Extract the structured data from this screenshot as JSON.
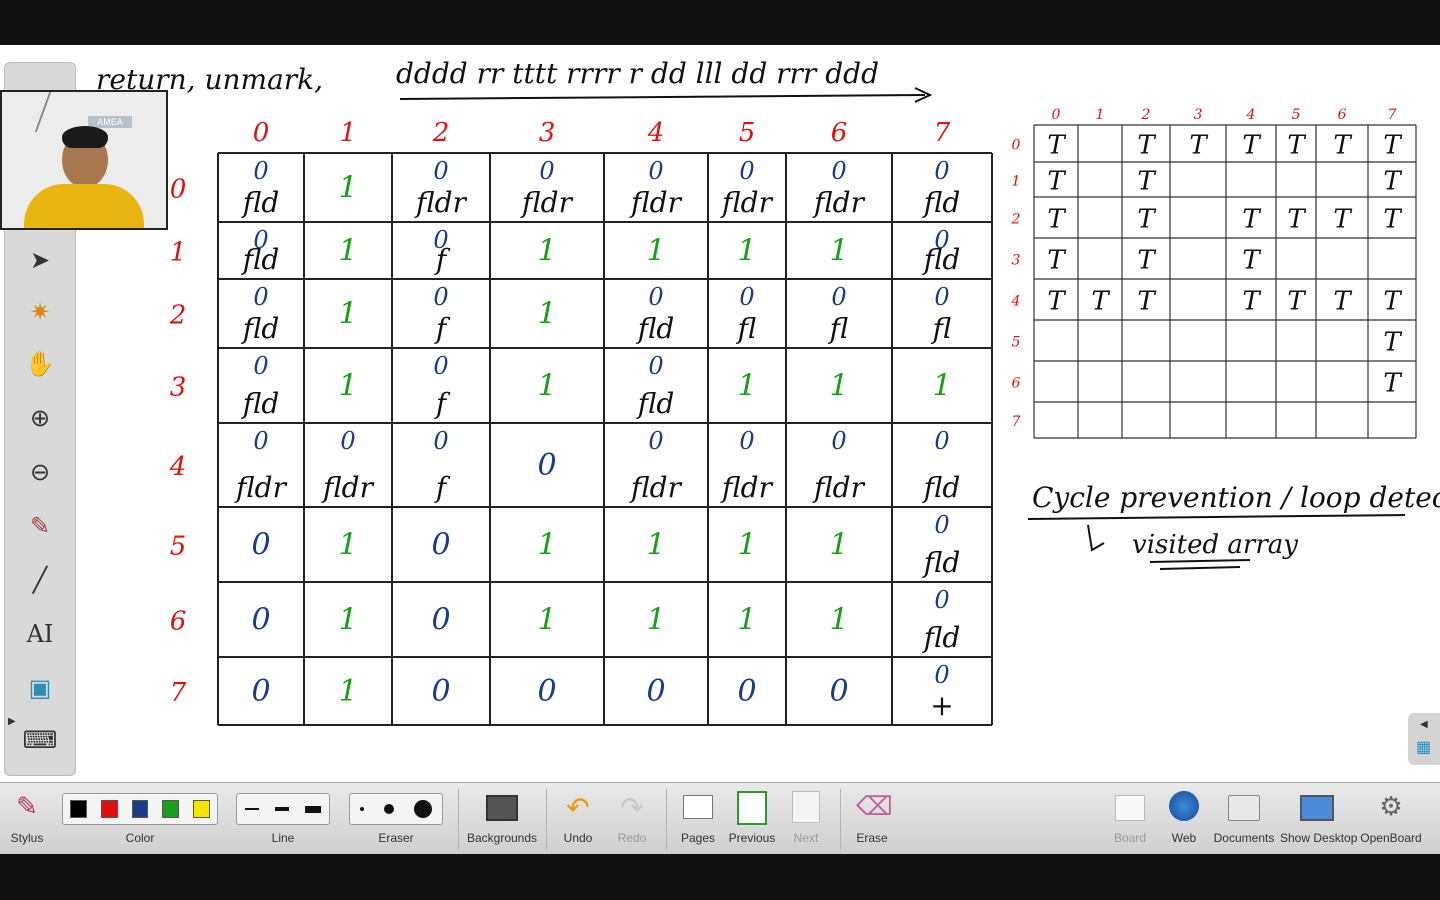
{
  "board": {
    "top_note": "return, unmark,",
    "path_string": "dddd rr tttt rrrr r dd lll dd rrr ddd",
    "columns": [
      "0",
      "1",
      "2",
      "3",
      "4",
      "5",
      "6",
      "7"
    ],
    "rows": [
      "0",
      "1",
      "2",
      "3",
      "4",
      "5",
      "6",
      "7"
    ],
    "grid": [
      [
        "0 fld",
        "1",
        "0 fldr",
        "0 fldr",
        "0 fldr",
        "0 fldr",
        "0 fldr",
        "0 fld"
      ],
      [
        "0 fld",
        "1",
        "0 f",
        "1",
        "1",
        "1",
        "1",
        "0 fld"
      ],
      [
        "0 fld",
        "1",
        "0 f",
        "1",
        "0 fld",
        "0 fl",
        "0 fl",
        "0 fl"
      ],
      [
        "0 fld",
        "1",
        "0 f",
        "1",
        "0 fld",
        "1",
        "1",
        "1"
      ],
      [
        "0 fldr",
        "0 fldr",
        "0 f",
        "0",
        "0 fldr",
        "0 fldr",
        "0 fldr",
        "0 fld"
      ],
      [
        "0",
        "1",
        "0",
        "1",
        "1",
        "1",
        "1",
        "0 fld"
      ],
      [
        "0",
        "1",
        "0",
        "1",
        "1",
        "1",
        "1",
        "0 fld"
      ],
      [
        "0",
        "1",
        "0",
        "0",
        "0",
        "0",
        "0",
        "0 +"
      ]
    ],
    "visited": {
      "columns": [
        "0",
        "1",
        "2",
        "3",
        "4",
        "5",
        "6",
        "7"
      ],
      "rows": [
        "0",
        "1",
        "2",
        "3",
        "4",
        "5",
        "6",
        "7"
      ],
      "cells": [
        [
          "T",
          "",
          "T",
          "T",
          "T",
          "T",
          "T",
          "T"
        ],
        [
          "T",
          "",
          "T",
          "",
          "",
          "",
          "",
          "T"
        ],
        [
          "T",
          "",
          "T",
          "",
          "T",
          "T",
          "T",
          "T"
        ],
        [
          "T",
          "",
          "T",
          "",
          "T",
          "",
          "",
          ""
        ],
        [
          "T",
          "T",
          "T",
          "",
          "T",
          "T",
          "T",
          "T"
        ],
        [
          "",
          "",
          "",
          "",
          "",
          "",
          "",
          "T"
        ],
        [
          "",
          "",
          "",
          "",
          "",
          "",
          "",
          "T"
        ],
        [
          "",
          "",
          "",
          "",
          "",
          "",
          "",
          ""
        ]
      ]
    },
    "note_line1": "Cycle prevention / loop detection",
    "note_line2": "visited array"
  },
  "webcam": {
    "badge": "AMEA"
  },
  "side_tools": [
    "pointer-icon",
    "laser-icon",
    "hand-icon",
    "zoom-in-icon",
    "zoom-out-icon",
    "pen-icon",
    "line-icon",
    "text-icon",
    "capture-icon",
    "keyboard-icon"
  ],
  "toolbar": {
    "stylus": "Stylus",
    "color": "Color",
    "line": "Line",
    "eraser": "Eraser",
    "backgrounds": "Backgrounds",
    "undo": "Undo",
    "redo": "Redo",
    "pages": "Pages",
    "previous": "Previous",
    "next": "Next",
    "erase": "Erase",
    "board": "Board",
    "web": "Web",
    "documents": "Documents",
    "show_desktop": "Show Desktop",
    "openboard": "OpenBoard"
  },
  "colors": {
    "ink_black": "#111111",
    "ink_red": "#e01010",
    "ink_blue": "#1a3b8c",
    "ink_green": "#18a018",
    "swatches": [
      "#000000",
      "#e01010",
      "#1a3b8c",
      "#18a018",
      "#f5e400"
    ]
  }
}
